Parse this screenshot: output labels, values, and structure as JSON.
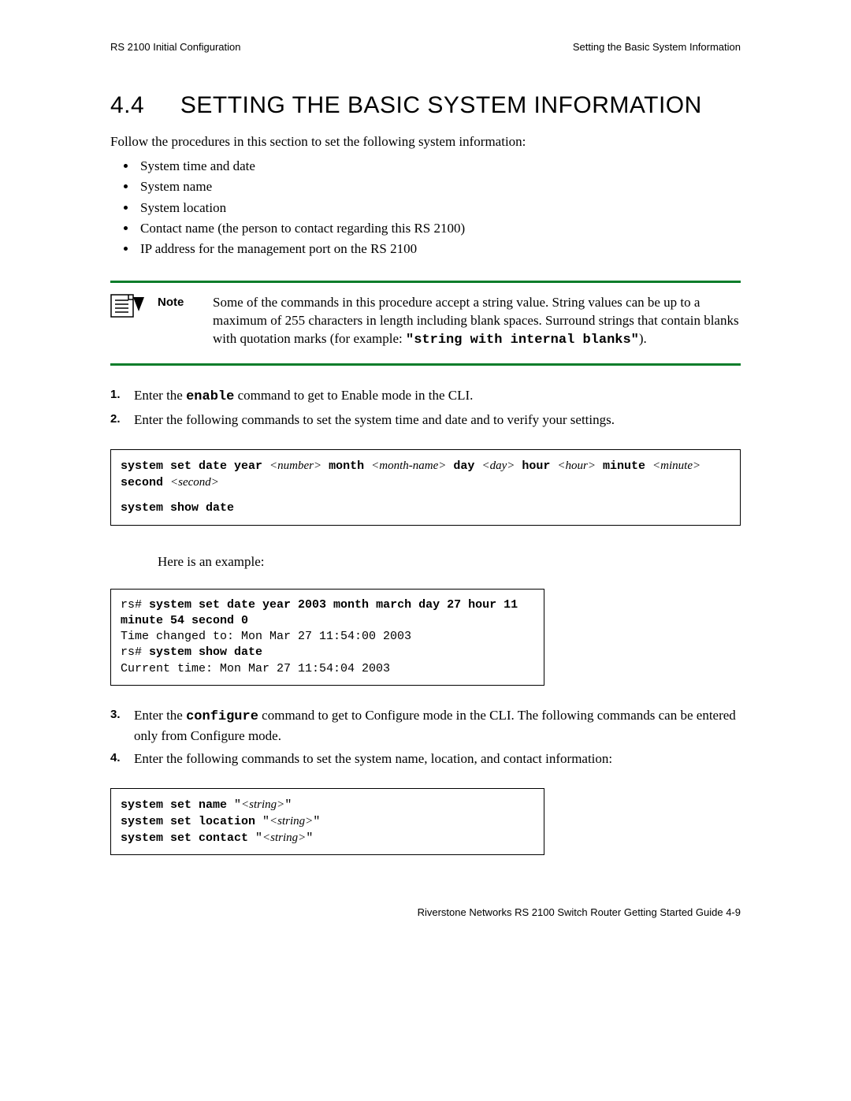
{
  "header": {
    "left": "RS 2100 Initial Configuration",
    "right": "Setting the Basic System Information"
  },
  "section": {
    "number": "4.4",
    "title": "SETTING THE BASIC SYSTEM INFORMATION"
  },
  "intro": "Follow the procedures in this section to set the following system information:",
  "bullets": [
    "System time and date",
    "System name",
    "System location",
    "Contact name (the person to contact regarding this RS 2100)",
    "IP address for the management port on the RS 2100"
  ],
  "note": {
    "label": "Note",
    "text_pre": "Some of the commands in this procedure accept a string value. String values can be up to a maximum of 255 characters in length including blank spaces. Surround strings that contain blanks with quotation marks (for example: ",
    "code_example": "\"string with internal blanks\"",
    "text_post": ")."
  },
  "steps_a": {
    "s1_pre": "Enter the ",
    "s1_cmd": "enable",
    "s1_post": " command to get to Enable mode in the CLI.",
    "s2": "Enter the following commands to set the system time and date and to verify your settings."
  },
  "codebox1": {
    "k1": "system set date year",
    "p1": "<number>",
    "k2": "month",
    "p2": "<month-name>",
    "k3": "day",
    "p3": "<day>",
    "k4": "hour",
    "p4": "<hour>",
    "k5": "minute",
    "p5": "<minute>",
    "k6": "second",
    "p6": "<second>",
    "line2": "system show date"
  },
  "example_label": "Here is an example:",
  "codebox2": {
    "l1_prompt": "rs# ",
    "l1_cmd": "system set date year 2003 month march day 27 hour 11 minute 54 second 0",
    "l2": "Time changed to: Mon Mar 27 11:54:00 2003",
    "l3_prompt": "rs# ",
    "l3_cmd": "system show date",
    "l4": "Current time: Mon Mar 27 11:54:04 2003"
  },
  "steps_b": {
    "s3_pre": "Enter the ",
    "s3_cmd": "configure",
    "s3_post": " command to get to Configure mode in the CLI. The following commands can be entered only from Configure mode.",
    "s4": "Enter the following commands to set the system name, location, and contact information:"
  },
  "codebox3": {
    "l1_cmd": "system set name",
    "l1_q1": " \"",
    "l1_str": "<string>",
    "l1_q2": "\"",
    "l2_cmd": "system set location",
    "l2_q1": " \"",
    "l2_str": "<string>",
    "l2_q2": "\"",
    "l3_cmd": "system set contact",
    "l3_q1": " \"",
    "l3_str": "<string>",
    "l3_q2": "\""
  },
  "footer": {
    "text": "Riverstone Networks RS 2100 Switch Router Getting Started Guide   4-9"
  }
}
